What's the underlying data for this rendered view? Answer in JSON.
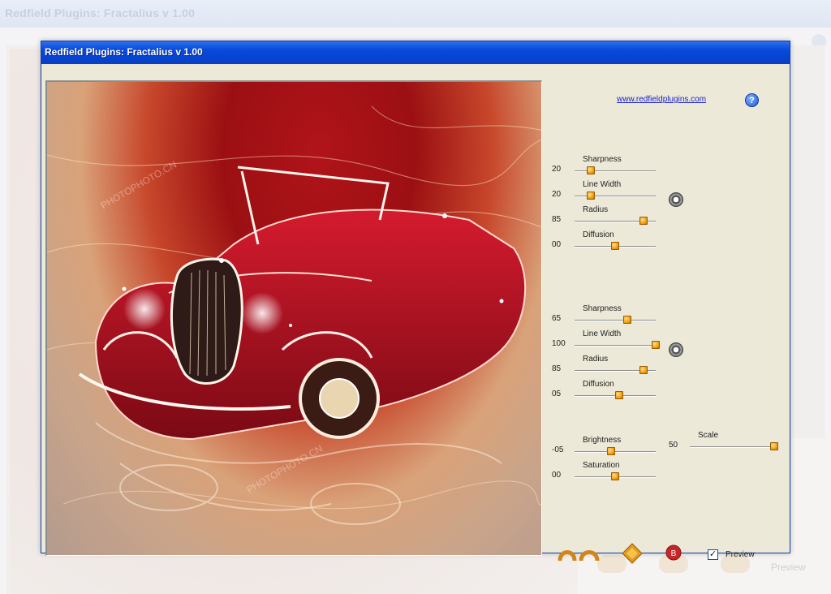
{
  "background": {
    "title": "Redfield Plugins: Fractalius v 1.00",
    "preview_label": "Preview"
  },
  "window": {
    "title": "Redfield Plugins: Fractalius v 1.00"
  },
  "panel": {
    "website_link": "www.redfieldplugins.com",
    "help_icon": "question-icon",
    "group1": [
      {
        "label": "Sharpness",
        "value": "20",
        "level": 0.2
      },
      {
        "label": "Line Width",
        "value": "20",
        "level": 0.2
      },
      {
        "label": "Radius",
        "value": "85",
        "level": 0.85
      },
      {
        "label": "Diffusion",
        "value": "00",
        "level": 0.5
      }
    ],
    "group2": [
      {
        "label": "Sharpness",
        "value": "65",
        "level": 0.65
      },
      {
        "label": "Line Width",
        "value": "100",
        "level": 1.0
      },
      {
        "label": "Radius",
        "value": "85",
        "level": 0.85
      },
      {
        "label": "Diffusion",
        "value": "05",
        "level": 0.55
      }
    ],
    "group3": [
      {
        "label": "Brightness",
        "value": "-05",
        "level": 0.45
      },
      {
        "label": "Saturation",
        "value": "00",
        "level": 0.5
      }
    ],
    "scale": {
      "label": "Scale",
      "value": "50",
      "level": 1.0
    },
    "preview_checkbox": {
      "label": "Preview",
      "checked": true
    },
    "icons": [
      "gear-icon",
      "undo-redo-icon",
      "move-icon",
      "reset-icon"
    ],
    "colors": {
      "accent": "#0a4bdc",
      "thumb": "#f0a010",
      "panel_bg": "#ece9d8"
    }
  },
  "watermarks": [
    "PHOTOPHOTO.CN",
    "PHOTOPHOTO.CN",
    "PHOTOPHOTO.CN",
    "PHOTOPHOTO.CN"
  ]
}
